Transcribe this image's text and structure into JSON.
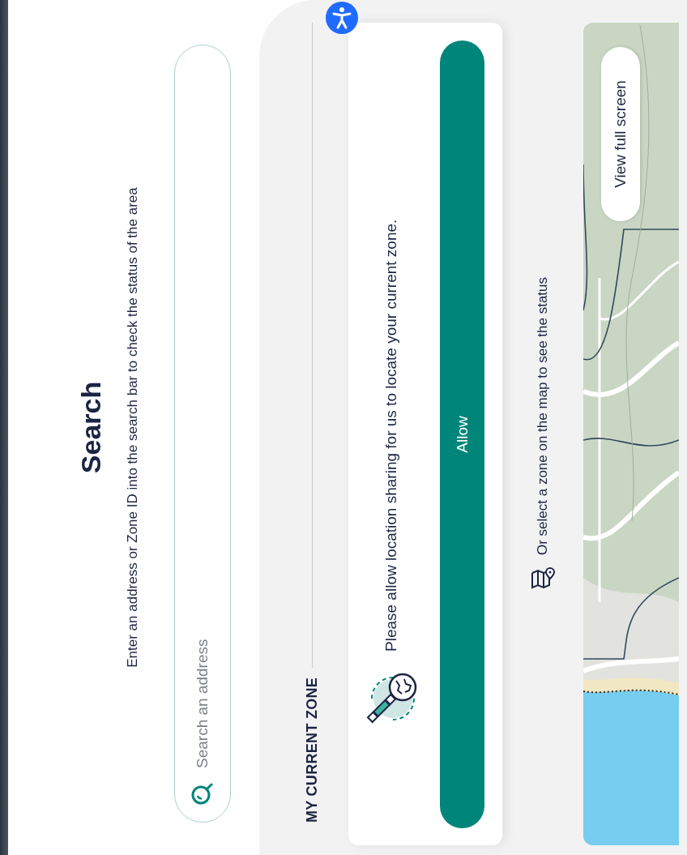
{
  "header": {
    "title": "Search",
    "subtitle": "Enter an address or Zone ID into the search bar to check the status of the area"
  },
  "search": {
    "placeholder": "Search an address"
  },
  "current_zone": {
    "heading": "MY CURRENT ZONE",
    "message": "Please allow location sharing for us to locate your current zone.",
    "button": "Allow"
  },
  "map_section": {
    "hint": "Or select a zone on the map to see the status",
    "map": {
      "kind": "picture",
      "button": "View full screen"
    }
  }
}
